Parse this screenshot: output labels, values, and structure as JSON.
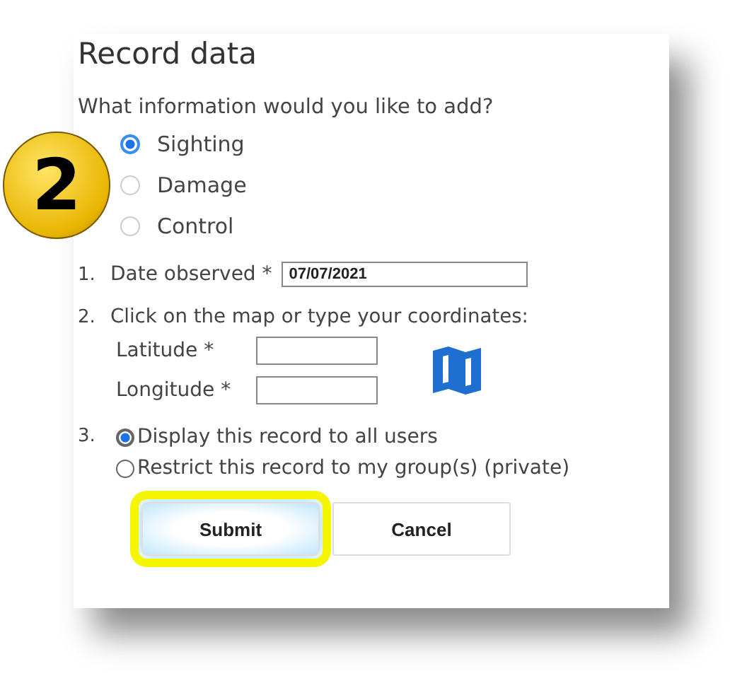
{
  "title": "Record data",
  "question": "What information would you like to add?",
  "badge": "2",
  "record_types": [
    {
      "label": "Sighting",
      "selected": true
    },
    {
      "label": "Damage",
      "selected": false
    },
    {
      "label": "Control",
      "selected": false
    }
  ],
  "date": {
    "number": "1.",
    "label": "Date observed *",
    "value": "07/07/2021"
  },
  "location": {
    "number": "2.",
    "instruction": "Click on the map or type your coordinates:",
    "fields": [
      {
        "label": "Latitude *"
      },
      {
        "label": "Longitude *"
      }
    ]
  },
  "visibility": {
    "number": "3.",
    "options": [
      {
        "label": "Display this record to all users",
        "selected": true
      },
      {
        "label": "Restrict this record to my group(s) (private)",
        "selected": false
      }
    ]
  },
  "buttons": [
    {
      "label": "Submit",
      "highlighted": true
    },
    {
      "label": "Cancel",
      "highlighted": false
    }
  ]
}
